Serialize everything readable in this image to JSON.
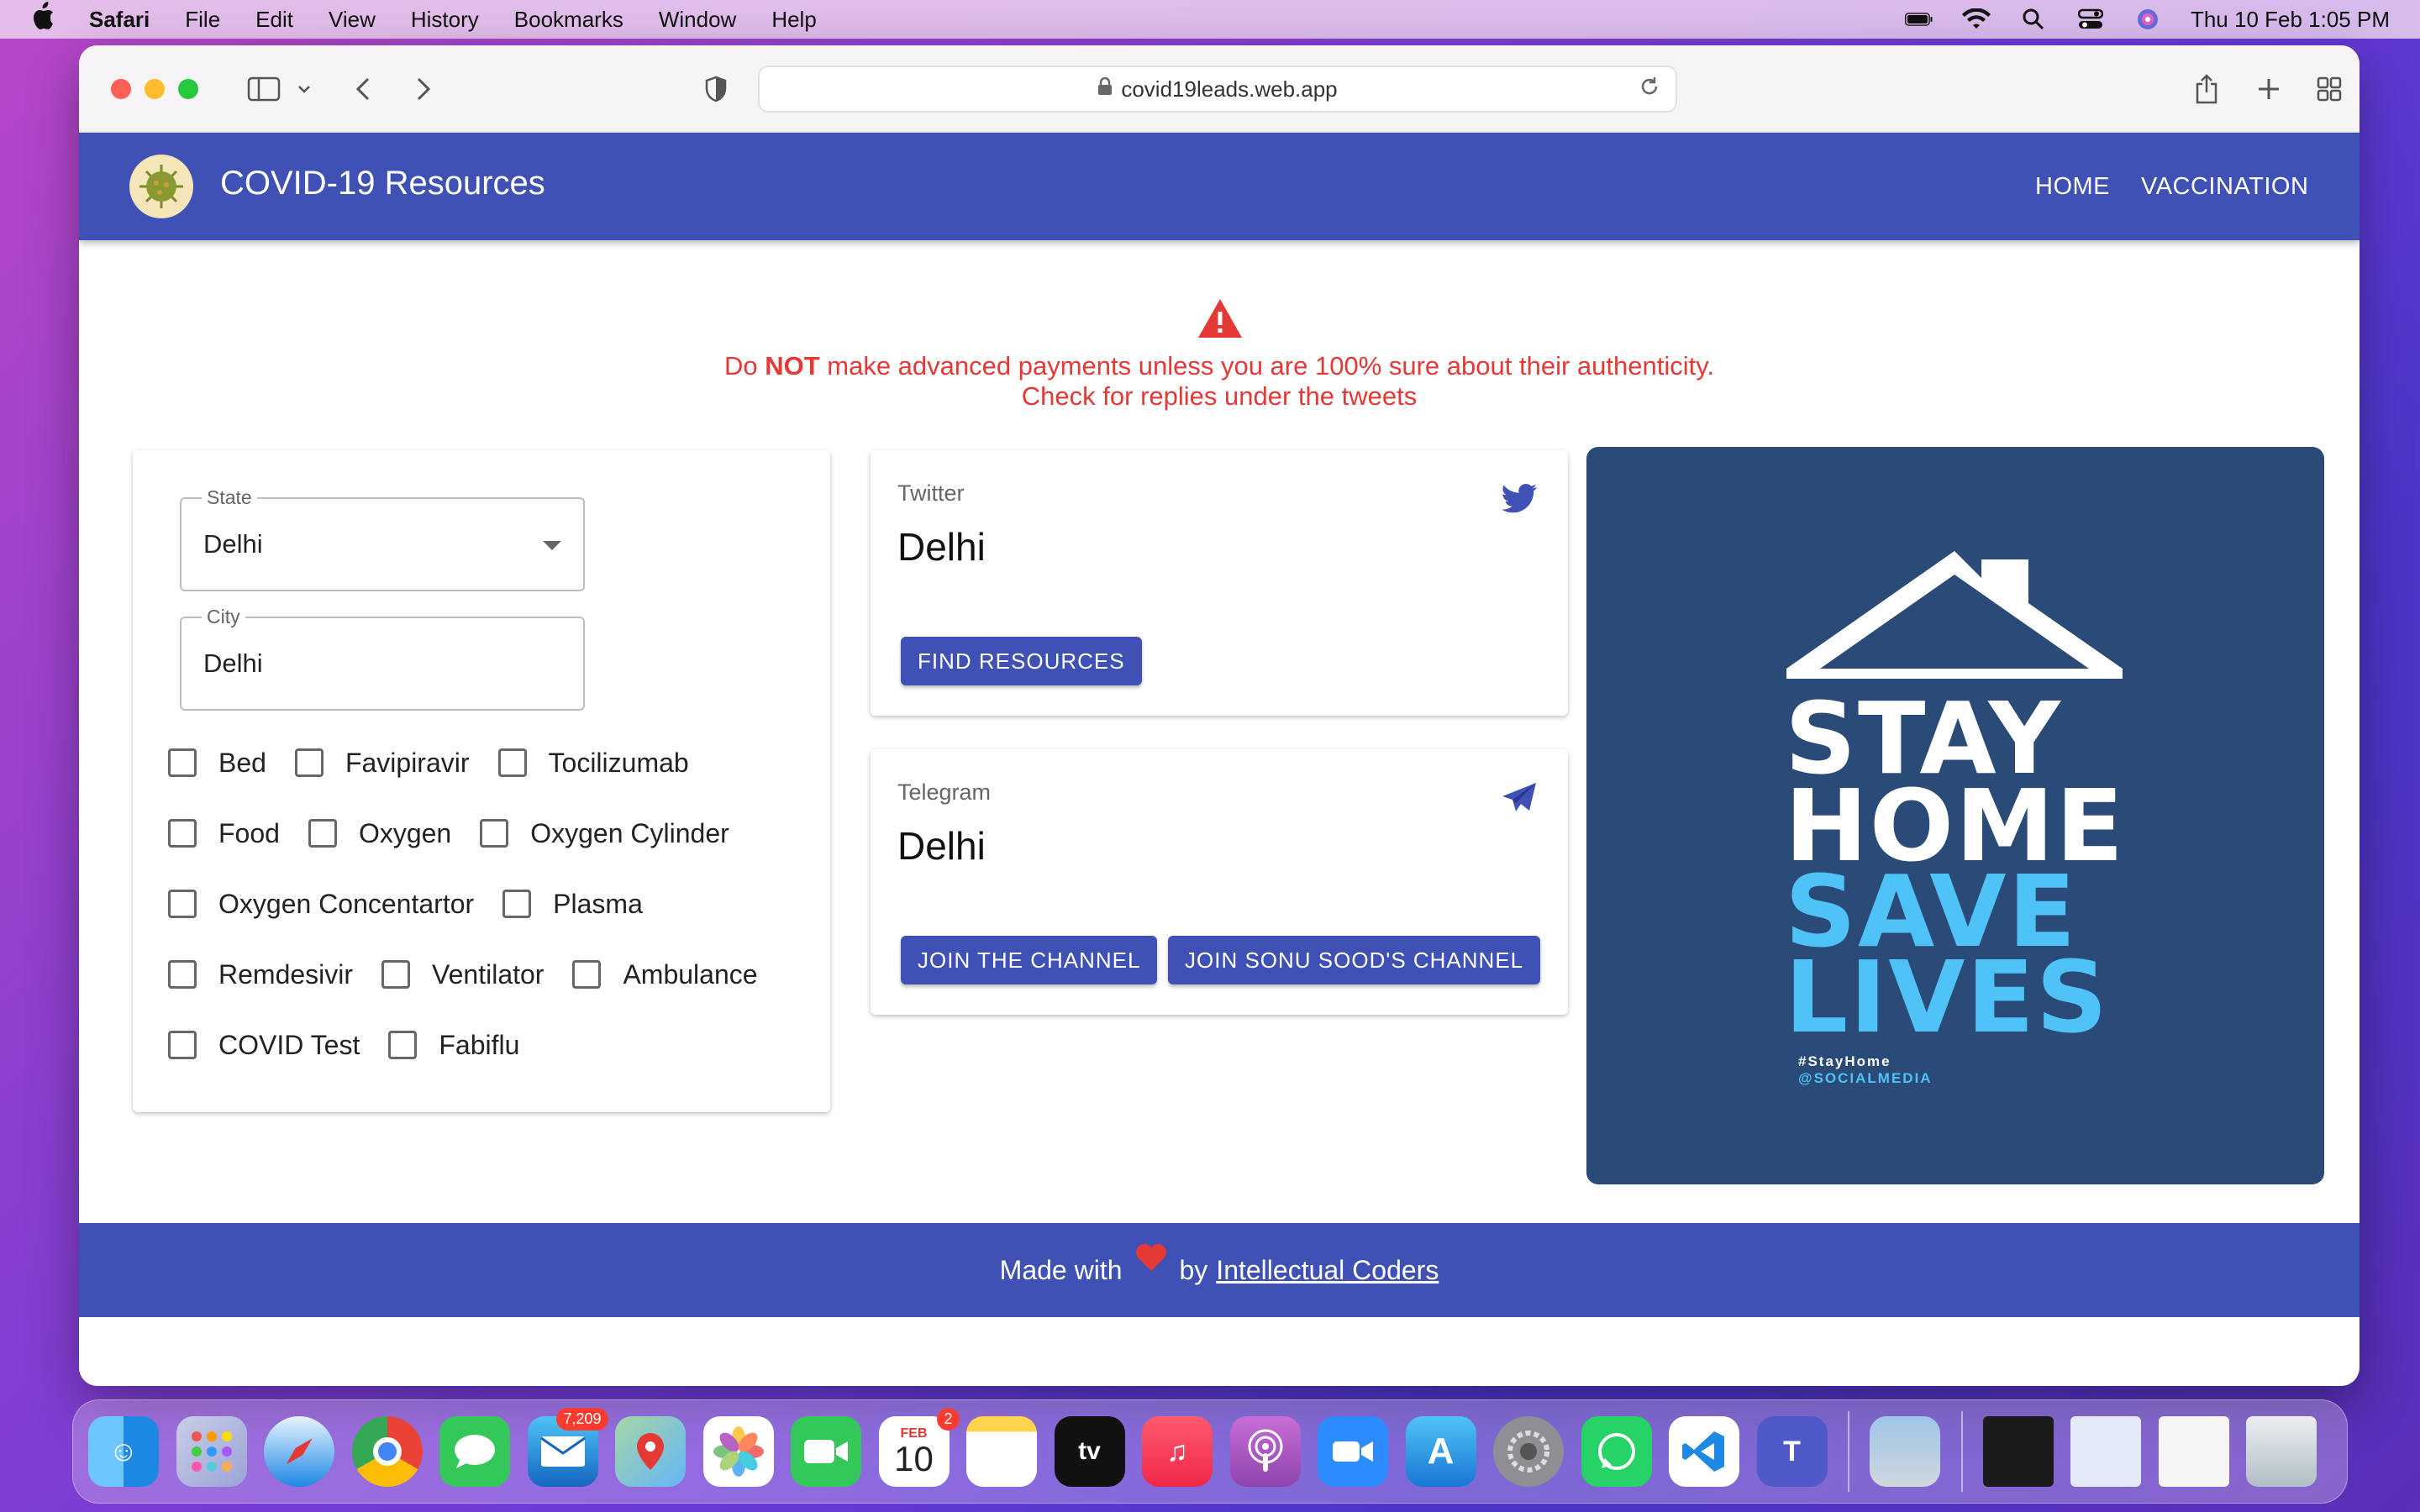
{
  "menubar": {
    "items": [
      "Safari",
      "File",
      "Edit",
      "View",
      "History",
      "Bookmarks",
      "Window",
      "Help"
    ],
    "datetime": "Thu 10 Feb  1:05 PM",
    "status_icons": [
      "battery-icon",
      "wifi-icon",
      "spotlight-icon",
      "control-center-icon",
      "siri-icon"
    ]
  },
  "browser": {
    "url": "covid19leads.web.app"
  },
  "appbar": {
    "title": "COVID-19 Resources",
    "nav": [
      "HOME",
      "VACCINATION"
    ]
  },
  "warning": {
    "line1_pre": "Do ",
    "line1_bold": "NOT",
    "line1_post": " make advanced payments unless you are 100% sure about their authenticity.",
    "line2": "Check for replies under the tweets"
  },
  "filters": {
    "state_label": "State",
    "state_value": "Delhi",
    "city_label": "City",
    "city_value": "Delhi",
    "checkbox_rows": [
      [
        "Bed",
        "Favipiravir",
        "Tocilizumab"
      ],
      [
        "Food",
        "Oxygen",
        "Oxygen Cylinder"
      ],
      [
        "Oxygen Concentartor",
        "Plasma"
      ],
      [
        "Remdesivir",
        "Ventilator",
        "Ambulance"
      ],
      [
        "COVID Test",
        "Fabiflu"
      ]
    ]
  },
  "twitter_card": {
    "subtitle": "Twitter",
    "title": "Delhi",
    "button": "FIND RESOURCES"
  },
  "telegram_card": {
    "subtitle": "Telegram",
    "title": "Delhi",
    "button1": "JOIN THE CHANNEL",
    "button2": "JOIN SONU SOOD'S CHANNEL"
  },
  "poster": {
    "lines": [
      "STAY",
      "HOME",
      "SAVE",
      "LIVES"
    ],
    "hashtag": "#StayHome",
    "handle": "@SOCIALMEDIA"
  },
  "footer": {
    "made_with": "Made with",
    "by": "by",
    "link": "Intellectual Coders"
  },
  "dock": {
    "mail_badge": "7,209",
    "calendar_month": "FEB",
    "calendar_day": "10",
    "calendar_badge": "2"
  },
  "colors": {
    "primary": "#3f51b5",
    "warning": "#e53935",
    "poster_bg": "#2a4a78",
    "poster_accent": "#4fc3f7"
  }
}
